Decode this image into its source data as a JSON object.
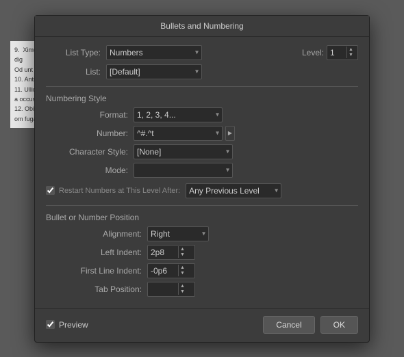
{
  "dialog": {
    "title": "Bullets and Numbering",
    "list_type_label": "List Type:",
    "list_type_value": "Numbers",
    "list_label": "List:",
    "list_value": "[Default]",
    "level_label": "Level:",
    "level_value": "1",
    "numbering_style_label": "Numbering Style",
    "format_label": "Format:",
    "format_value": "1, 2, 3, 4...",
    "number_label": "Number:",
    "number_value": "^#.^t",
    "character_style_label": "Character Style:",
    "character_style_value": "[None]",
    "mode_label": "Mode:",
    "mode_value": "",
    "restart_label": "Restart Numbers at This Level After:",
    "restart_checked": true,
    "restart_option": "Any Previous Level",
    "position_label": "Bullet or Number Position",
    "alignment_label": "Alignment:",
    "alignment_value": "Right",
    "left_indent_label": "Left Indent:",
    "left_indent_value": "2p8",
    "first_line_indent_label": "First Line Indent:",
    "first_line_indent_value": "-0p6",
    "tab_position_label": "Tab Position:",
    "tab_position_value": "",
    "preview_label": "Preview",
    "preview_checked": true,
    "cancel_label": "Cancel",
    "ok_label": "OK"
  }
}
